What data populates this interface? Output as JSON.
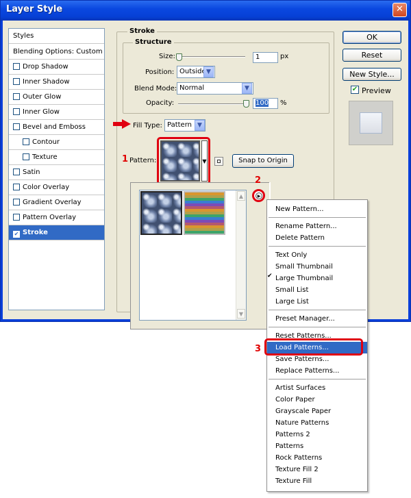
{
  "window": {
    "title": "Layer Style",
    "close": "✕"
  },
  "styles_list": {
    "header": "Styles",
    "blending": "Blending Options: Custom",
    "items": [
      {
        "label": "Drop Shadow"
      },
      {
        "label": "Inner Shadow"
      },
      {
        "label": "Outer Glow"
      },
      {
        "label": "Inner Glow"
      },
      {
        "label": "Bevel and Emboss"
      },
      {
        "label": "Contour"
      },
      {
        "label": "Texture"
      },
      {
        "label": "Satin"
      },
      {
        "label": "Color Overlay"
      },
      {
        "label": "Gradient Overlay"
      },
      {
        "label": "Pattern Overlay"
      },
      {
        "label": "Stroke",
        "checked": true,
        "selected": true
      }
    ]
  },
  "buttons": {
    "ok": "OK",
    "reset": "Reset",
    "new_style": "New Style...",
    "preview": "Preview"
  },
  "stroke": {
    "group_label": "Stroke",
    "structure_label": "Structure",
    "size_label": "Size:",
    "size_value": "1",
    "size_unit": "px",
    "position_label": "Position:",
    "position_value": "Outside",
    "blend_label": "Blend Mode:",
    "blend_value": "Normal",
    "opacity_label": "Opacity:",
    "opacity_value": "100",
    "opacity_unit": "%",
    "fill_type_label": "Fill Type:",
    "fill_type_value": "Pattern",
    "pattern_label": "Pattern:",
    "snap_button": "Snap to Origin"
  },
  "annotations": {
    "n1": "1",
    "n2": "2",
    "n3": "3"
  },
  "menu": {
    "groups": [
      [
        "New Pattern..."
      ],
      [
        "Rename Pattern...",
        "Delete Pattern"
      ],
      [
        "Text Only",
        "Small Thumbnail",
        "Large Thumbnail",
        "Small List",
        "Large List"
      ],
      [
        "Preset Manager..."
      ],
      [
        "Reset Patterns...",
        "Load Patterns...",
        "Save Patterns...",
        "Replace Patterns..."
      ],
      [
        "Artist Surfaces",
        "Color Paper",
        "Grayscale Paper",
        "Nature Patterns",
        "Patterns 2",
        "Patterns",
        "Rock Patterns",
        "Texture Fill 2",
        "Texture Fill"
      ]
    ],
    "checked_item": "Large Thumbnail",
    "highlighted_item": "Load Patterns..."
  },
  "colors": {
    "accent": "#316ac5",
    "annotation_red": "#e00010",
    "titlebar": "#0a48e0"
  }
}
